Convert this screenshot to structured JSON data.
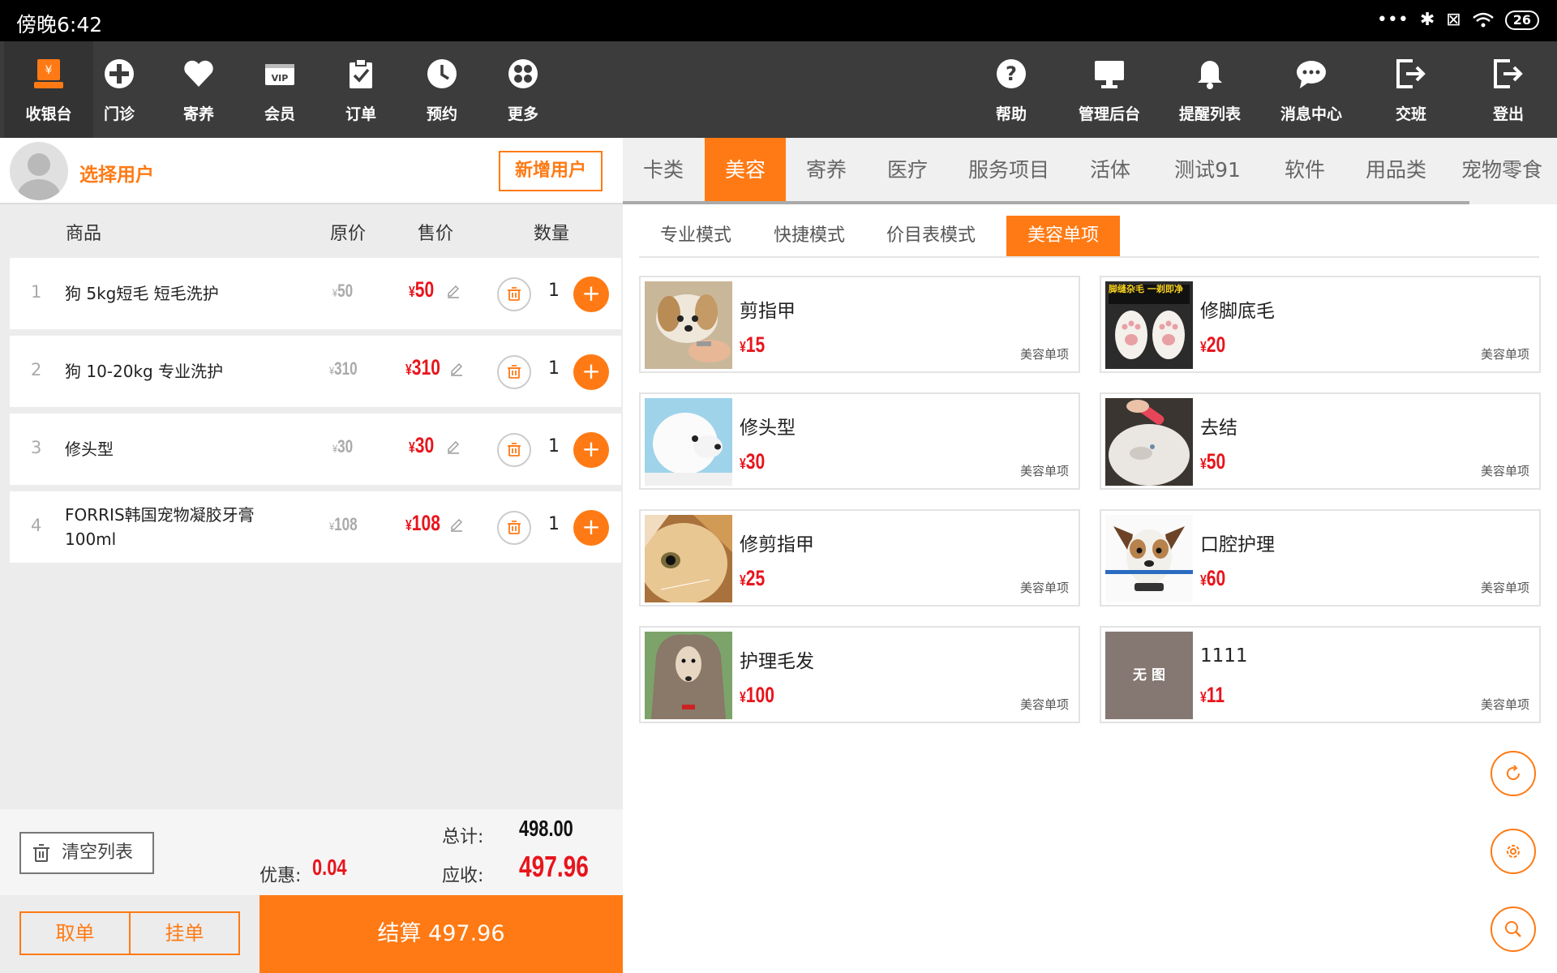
{
  "status": {
    "time": "傍晚6:42",
    "battery": "26"
  },
  "nav": {
    "left": [
      {
        "label": "收银台",
        "icon": "cash-register-icon"
      },
      {
        "label": "门诊",
        "icon": "medical-cross-icon"
      },
      {
        "label": "寄养",
        "icon": "heart-icon"
      },
      {
        "label": "会员",
        "icon": "vip-card-icon"
      },
      {
        "label": "订单",
        "icon": "clipboard-check-icon"
      },
      {
        "label": "预约",
        "icon": "clock-icon"
      },
      {
        "label": "更多",
        "icon": "grid-more-icon"
      }
    ],
    "right": [
      {
        "label": "帮助",
        "icon": "help-icon"
      },
      {
        "label": "管理后台",
        "icon": "monitor-icon"
      },
      {
        "label": "提醒列表",
        "icon": "bell-icon"
      },
      {
        "label": "消息中心",
        "icon": "chat-icon"
      },
      {
        "label": "交班",
        "icon": "handover-icon"
      },
      {
        "label": "登出",
        "icon": "logout-icon"
      }
    ]
  },
  "user": {
    "select_label": "选择用户",
    "add_label": "新增用户"
  },
  "cart": {
    "headers": {
      "product": "商品",
      "orig": "原价",
      "sale": "售价",
      "qty": "数量"
    },
    "currency": "¥",
    "items": [
      {
        "index": "1",
        "name": "狗 5kg短毛 短毛洗护",
        "orig": "50",
        "sale": "50",
        "qty": "1"
      },
      {
        "index": "2",
        "name": "狗 10-20kg 专业洗护",
        "orig": "310",
        "sale": "310",
        "qty": "1"
      },
      {
        "index": "3",
        "name": "修头型",
        "orig": "30",
        "sale": "30",
        "qty": "1"
      },
      {
        "index": "4",
        "name": "FORRIS韩国宠物凝胶牙膏100ml",
        "orig": "108",
        "sale": "108",
        "qty": "1"
      }
    ]
  },
  "summary": {
    "clear_label": "清空列表",
    "total_label": "总计:",
    "total_value": "498.00",
    "discount_label": "优惠:",
    "discount_value": "0.04",
    "receivable_label": "应收:",
    "receivable_value": "497.96"
  },
  "actions": {
    "cancel_label": "取单",
    "hold_label": "挂单",
    "checkout_label": "结算 497.96"
  },
  "categories": [
    "卡类",
    "美容",
    "寄养",
    "医疗",
    "服务项目",
    "活体",
    "测试91",
    "软件",
    "用品类",
    "宠物零食"
  ],
  "active_category": 1,
  "subtabs": [
    "专业模式",
    "快捷模式",
    "价目表模式",
    "美容单项"
  ],
  "active_subtab": 3,
  "products": [
    {
      "name": "剪指甲",
      "price": "15",
      "category": "美容单项",
      "thumb": "dog-nail-trim"
    },
    {
      "name": "修脚底毛",
      "price": "20",
      "category": "美容单项",
      "thumb": "paw-fur",
      "thumb_text": "脚缝杂毛 一剃即净"
    },
    {
      "name": "修头型",
      "price": "30",
      "category": "美容单项",
      "thumb": "white-dog"
    },
    {
      "name": "去结",
      "price": "50",
      "category": "美容单项",
      "thumb": "cat-brush"
    },
    {
      "name": "修剪指甲",
      "price": "25",
      "category": "美容单项",
      "thumb": "cat-face"
    },
    {
      "name": "口腔护理",
      "price": "60",
      "category": "美容单项",
      "thumb": "dog-toothbrush"
    },
    {
      "name": "护理毛发",
      "price": "100",
      "category": "美容单项",
      "thumb": "afghan-hound"
    },
    {
      "name": "1111",
      "price": "11",
      "category": "美容单项",
      "thumb": "no-image",
      "thumb_text": "无 图"
    }
  ],
  "colors": {
    "accent": "#ff7a14",
    "price": "#e8141c",
    "nav_bg": "#3c3c3c"
  }
}
